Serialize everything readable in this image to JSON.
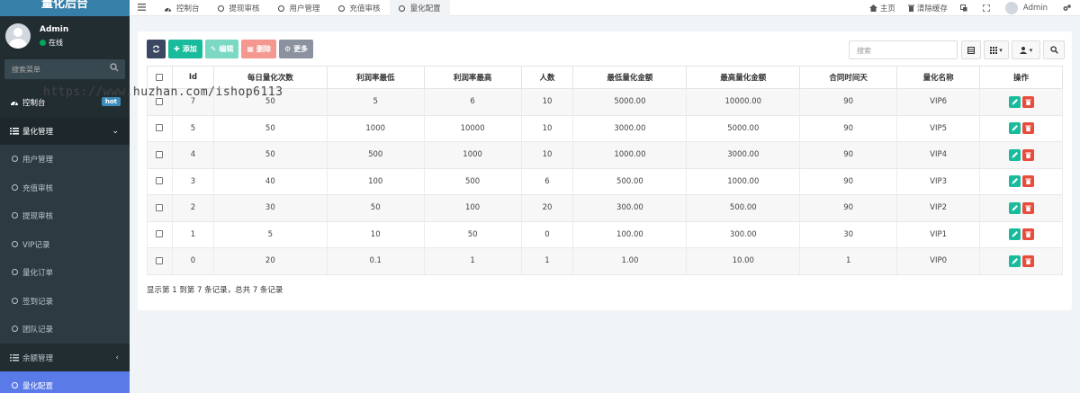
{
  "app": {
    "title": "量化后台"
  },
  "user": {
    "name": "Admin",
    "status": "在线"
  },
  "sidebar": {
    "search_placeholder": "搜索菜单",
    "items": [
      {
        "label": "控制台",
        "badge": "hot"
      },
      {
        "label": "量化管理"
      },
      {
        "label": "用户管理"
      },
      {
        "label": "充值审核"
      },
      {
        "label": "提现审核"
      },
      {
        "label": "VIP记录"
      },
      {
        "label": "量化订单"
      },
      {
        "label": "签到记录"
      },
      {
        "label": "团队记录"
      },
      {
        "label": "余额管理"
      },
      {
        "label": "量化配置"
      }
    ]
  },
  "topbar": {
    "tabs": [
      {
        "label": "控制台"
      },
      {
        "label": "提现审核"
      },
      {
        "label": "用户管理"
      },
      {
        "label": "充值审核"
      },
      {
        "label": "量化配置"
      }
    ],
    "home_label": "主页",
    "clear_cache_label": "清除缓存",
    "user_label": "Admin"
  },
  "toolbar": {
    "add_label": "添加",
    "edit_label": "编辑",
    "delete_label": "删除",
    "more_label": "更多",
    "search_placeholder": "搜索"
  },
  "table": {
    "columns": [
      "Id",
      "每日量化次数",
      "利润率最低",
      "利润率最高",
      "人数",
      "最低量化金额",
      "最高量化金额",
      "合同时间天",
      "量化名称",
      "操作"
    ],
    "rows": [
      [
        "7",
        "50",
        "5",
        "6",
        "10",
        "5000.00",
        "10000.00",
        "90",
        "VIP6"
      ],
      [
        "5",
        "50",
        "1000",
        "10000",
        "10",
        "3000.00",
        "5000.00",
        "90",
        "VIP5"
      ],
      [
        "4",
        "50",
        "500",
        "1000",
        "10",
        "1000.00",
        "3000.00",
        "90",
        "VIP4"
      ],
      [
        "3",
        "40",
        "100",
        "500",
        "6",
        "500.00",
        "1000.00",
        "90",
        "VIP3"
      ],
      [
        "2",
        "30",
        "50",
        "100",
        "20",
        "300.00",
        "500.00",
        "90",
        "VIP2"
      ],
      [
        "1",
        "5",
        "10",
        "50",
        "0",
        "100.00",
        "300.00",
        "30",
        "VIP1"
      ],
      [
        "0",
        "20",
        "0.1",
        "1",
        "1",
        "1.00",
        "10.00",
        "1",
        "VIP0"
      ]
    ]
  },
  "summary": "显示第 1 到第 7 条记录，总共 7 条记录",
  "watermark": "https://www.huzhan.com/ishop6113",
  "colors": {
    "sidebar_bg": "#222d32",
    "logo_bg": "#367fa9",
    "active_menu": "#5a7ae8",
    "add_green": "#18bc9c",
    "delete_red": "#e74c3c"
  }
}
